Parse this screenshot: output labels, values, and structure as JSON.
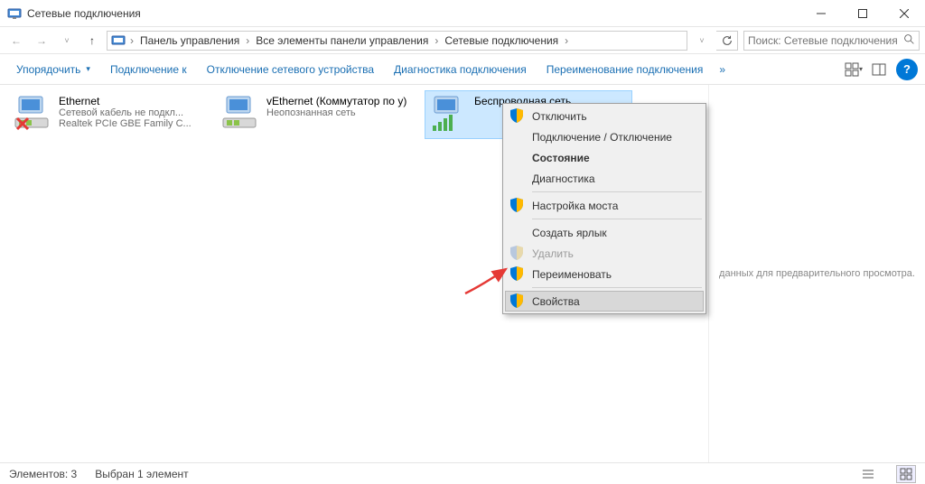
{
  "window": {
    "title": "Сетевые подключения"
  },
  "breadcrumb": {
    "items": [
      "Панель управления",
      "Все элементы панели управления",
      "Сетевые подключения"
    ]
  },
  "search": {
    "placeholder": "Поиск: Сетевые подключения"
  },
  "toolbar": {
    "organize": "Упорядочить",
    "connect": "Подключение к",
    "disable": "Отключение сетевого устройства",
    "diagnose": "Диагностика подключения",
    "rename": "Переименование подключения",
    "more": "»"
  },
  "connections": [
    {
      "name": "Ethernet",
      "status": "Сетевой кабель не подкл...",
      "device": "Realtek PCIe GBE Family C...",
      "unplugged": true,
      "selected": false
    },
    {
      "name": "vEthernet (Коммутатор по у)",
      "status": "Неопознанная сеть",
      "device": "",
      "unplugged": false,
      "selected": false
    },
    {
      "name": "Беспроводная сеть",
      "status": "",
      "device": "",
      "unplugged": false,
      "selected": true,
      "wireless": true
    }
  ],
  "preview": {
    "text": "данных для предварительного просмотра."
  },
  "context_menu": {
    "items": [
      {
        "label": "Отключить",
        "shield": true
      },
      {
        "label": "Подключение / Отключение"
      },
      {
        "label": "Состояние",
        "bold": true
      },
      {
        "label": "Диагностика"
      },
      {
        "sep": true
      },
      {
        "label": "Настройка моста",
        "shield": true
      },
      {
        "sep": true
      },
      {
        "label": "Создать ярлык"
      },
      {
        "label": "Удалить",
        "shield": true,
        "disabled": true
      },
      {
        "label": "Переименовать",
        "shield": true
      },
      {
        "sep": true
      },
      {
        "label": "Свойства",
        "shield": true,
        "hover": true
      }
    ]
  },
  "statusbar": {
    "count": "Элементов: 3",
    "selected": "Выбран 1 элемент"
  }
}
